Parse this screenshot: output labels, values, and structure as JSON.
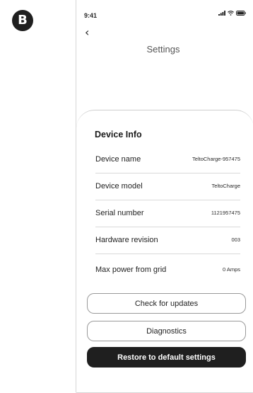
{
  "badge": {
    "label": "B"
  },
  "status_bar": {
    "time": "9:41"
  },
  "header": {
    "back_icon": "chevron-left-icon",
    "title": "Settings"
  },
  "device_info": {
    "title": "Device Info",
    "rows": [
      {
        "label": "Device name",
        "value": "TeltoCharge-957475"
      },
      {
        "label": "Device model",
        "value": "TeltoCharge"
      },
      {
        "label": "Serial number",
        "value": "1121957475"
      },
      {
        "label": "Hardware revision",
        "value": "003"
      },
      {
        "label": "Max power from grid",
        "value": "0 Amps"
      }
    ]
  },
  "actions": {
    "check_updates": "Check for updates",
    "diagnostics": "Diagnostics",
    "restore": "Restore to default settings"
  }
}
